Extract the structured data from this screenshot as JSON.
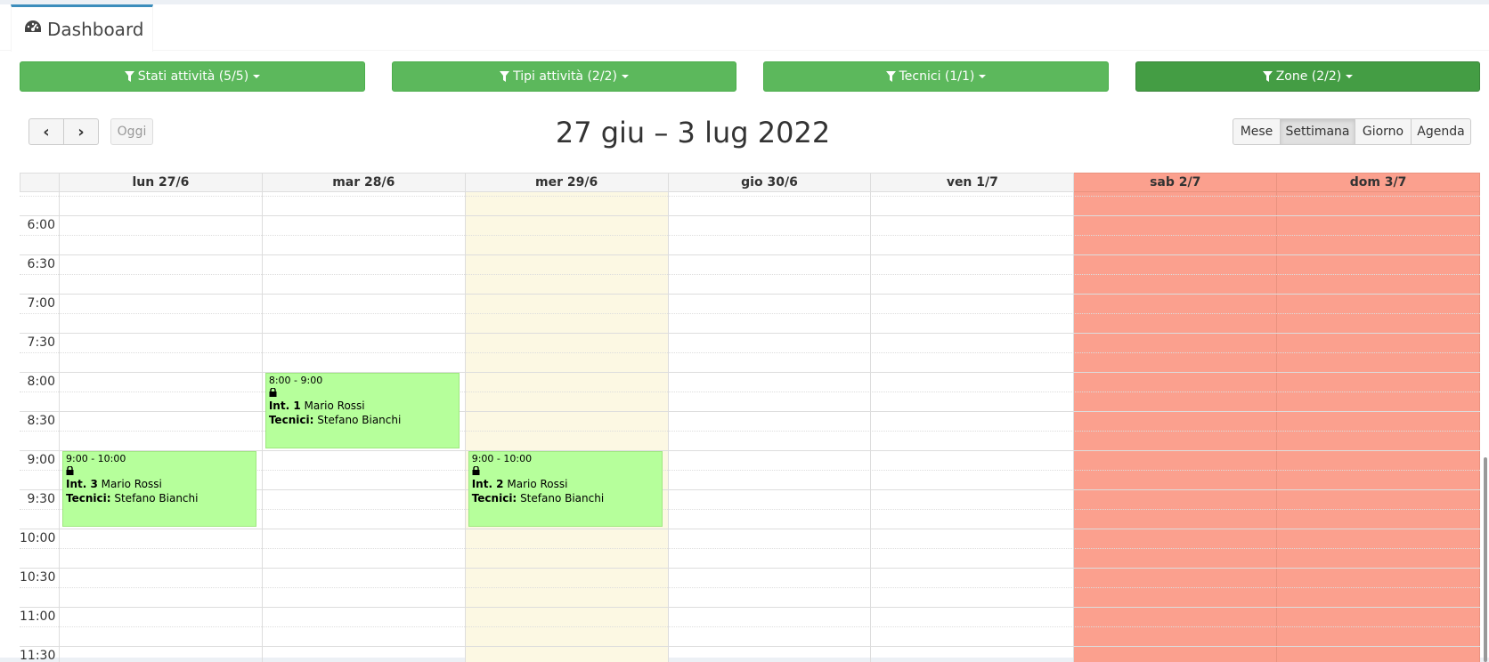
{
  "tab": {
    "label": "Dashboard",
    "icon": "tachometer-icon"
  },
  "filters": [
    {
      "label": "Stati attività (5/5)"
    },
    {
      "label": "Tipi attività (2/2)"
    },
    {
      "label": "Tecnici (1/1)"
    },
    {
      "label": "Zone (2/2)"
    }
  ],
  "toolbar": {
    "prev_label": "‹",
    "next_label": "›",
    "today_label": "Oggi",
    "title": "27 giu – 3 lug 2022",
    "views": [
      "Mese",
      "Settimana",
      "Giorno",
      "Agenda"
    ],
    "active_view": "Settimana"
  },
  "days": [
    {
      "label": "lun 27/6",
      "type": "normal"
    },
    {
      "label": "mar 28/6",
      "type": "normal"
    },
    {
      "label": "mer 29/6",
      "type": "today"
    },
    {
      "label": "gio 30/6",
      "type": "normal"
    },
    {
      "label": "ven 1/7",
      "type": "normal"
    },
    {
      "label": "sab 2/7",
      "type": "weekend"
    },
    {
      "label": "dom 3/7",
      "type": "weekend"
    }
  ],
  "time_labels": [
    "6:00",
    "6:30",
    "7:00",
    "7:30",
    "8:00",
    "8:30",
    "9:00",
    "9:30",
    "10:00",
    "10:30",
    "11:00",
    "11:30"
  ],
  "events": [
    {
      "time": "8:00 - 9:00",
      "code": "Int. 1",
      "client": "Mario Rossi",
      "tech_label": "Tecnici:",
      "tech": "Stefano Bianchi",
      "day": 1
    },
    {
      "time": "9:00 - 10:00",
      "code": "Int. 3",
      "client": "Mario Rossi",
      "tech_label": "Tecnici:",
      "tech": "Stefano Bianchi",
      "day": 0
    },
    {
      "time": "9:00 - 10:00",
      "code": "Int. 2",
      "client": "Mario Rossi",
      "tech_label": "Tecnici:",
      "tech": "Stefano Bianchi",
      "day": 2
    }
  ],
  "colors": {
    "filter_green": "#5cb85c",
    "today_bg": "#fcf8e3",
    "weekend_bg": "#fba08e",
    "event_bg": "#b6ff9b",
    "tab_accent": "#3c8dbc"
  }
}
